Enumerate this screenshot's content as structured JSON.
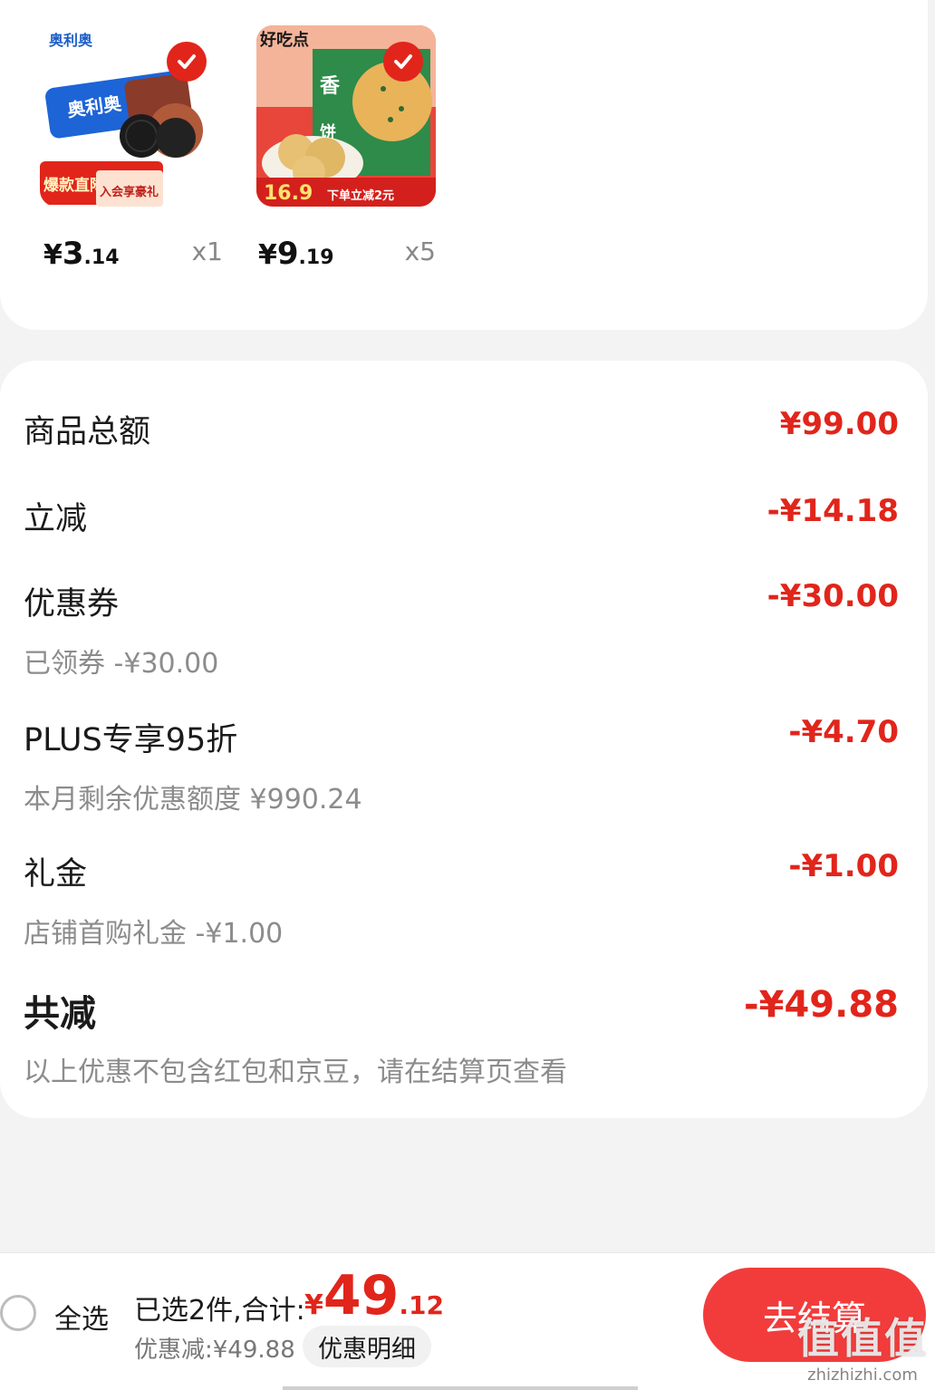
{
  "products": [
    {
      "name": "奥利奥",
      "image_badge": "爆款直降",
      "image_promo": "入会享豪礼",
      "price_yen": "¥",
      "price_int": "3",
      "price_dec": ".14",
      "qty": "x1",
      "selected": true
    },
    {
      "name": "好吃点",
      "image_brand": "好吃点",
      "image_label": "香酥饼",
      "image_price": "16.9",
      "image_promo": "下单立减2元",
      "price_yen": "¥",
      "price_int": "9",
      "price_dec": ".19",
      "qty": "x5",
      "selected": true
    }
  ],
  "summary": {
    "goods_total_label": "商品总额",
    "goods_total_value": "¥99.00",
    "instant_discount_label": "立减",
    "instant_discount_value": "-¥14.18",
    "coupon_label": "优惠券",
    "coupon_value": "-¥30.00",
    "coupon_sub": "已领券 -¥30.00",
    "plus_label": "PLUS专享95折",
    "plus_value": "-¥4.70",
    "plus_sub": "本月剩余优惠额度 ¥990.24",
    "gift_label": "礼金",
    "gift_value": "-¥1.00",
    "gift_sub": "店铺首购礼金 -¥1.00",
    "total_label": "共减",
    "total_value": "-¥49.88",
    "total_note": "以上优惠不包含红包和京豆，请在结算页查看"
  },
  "bottom_bar": {
    "select_all": "全选",
    "selected_text": "已选2件,合计:",
    "total_yen": "¥",
    "total_int": "49",
    "total_dec": ".12",
    "discount_text": "优惠减:¥49.88",
    "detail_button": "优惠明细",
    "checkout_button": "去结算"
  },
  "watermark": {
    "text": "值值值",
    "url": "zhizhizhi.com"
  },
  "colors": {
    "accent": "#e1251b",
    "checkout": "#f23c3c"
  }
}
